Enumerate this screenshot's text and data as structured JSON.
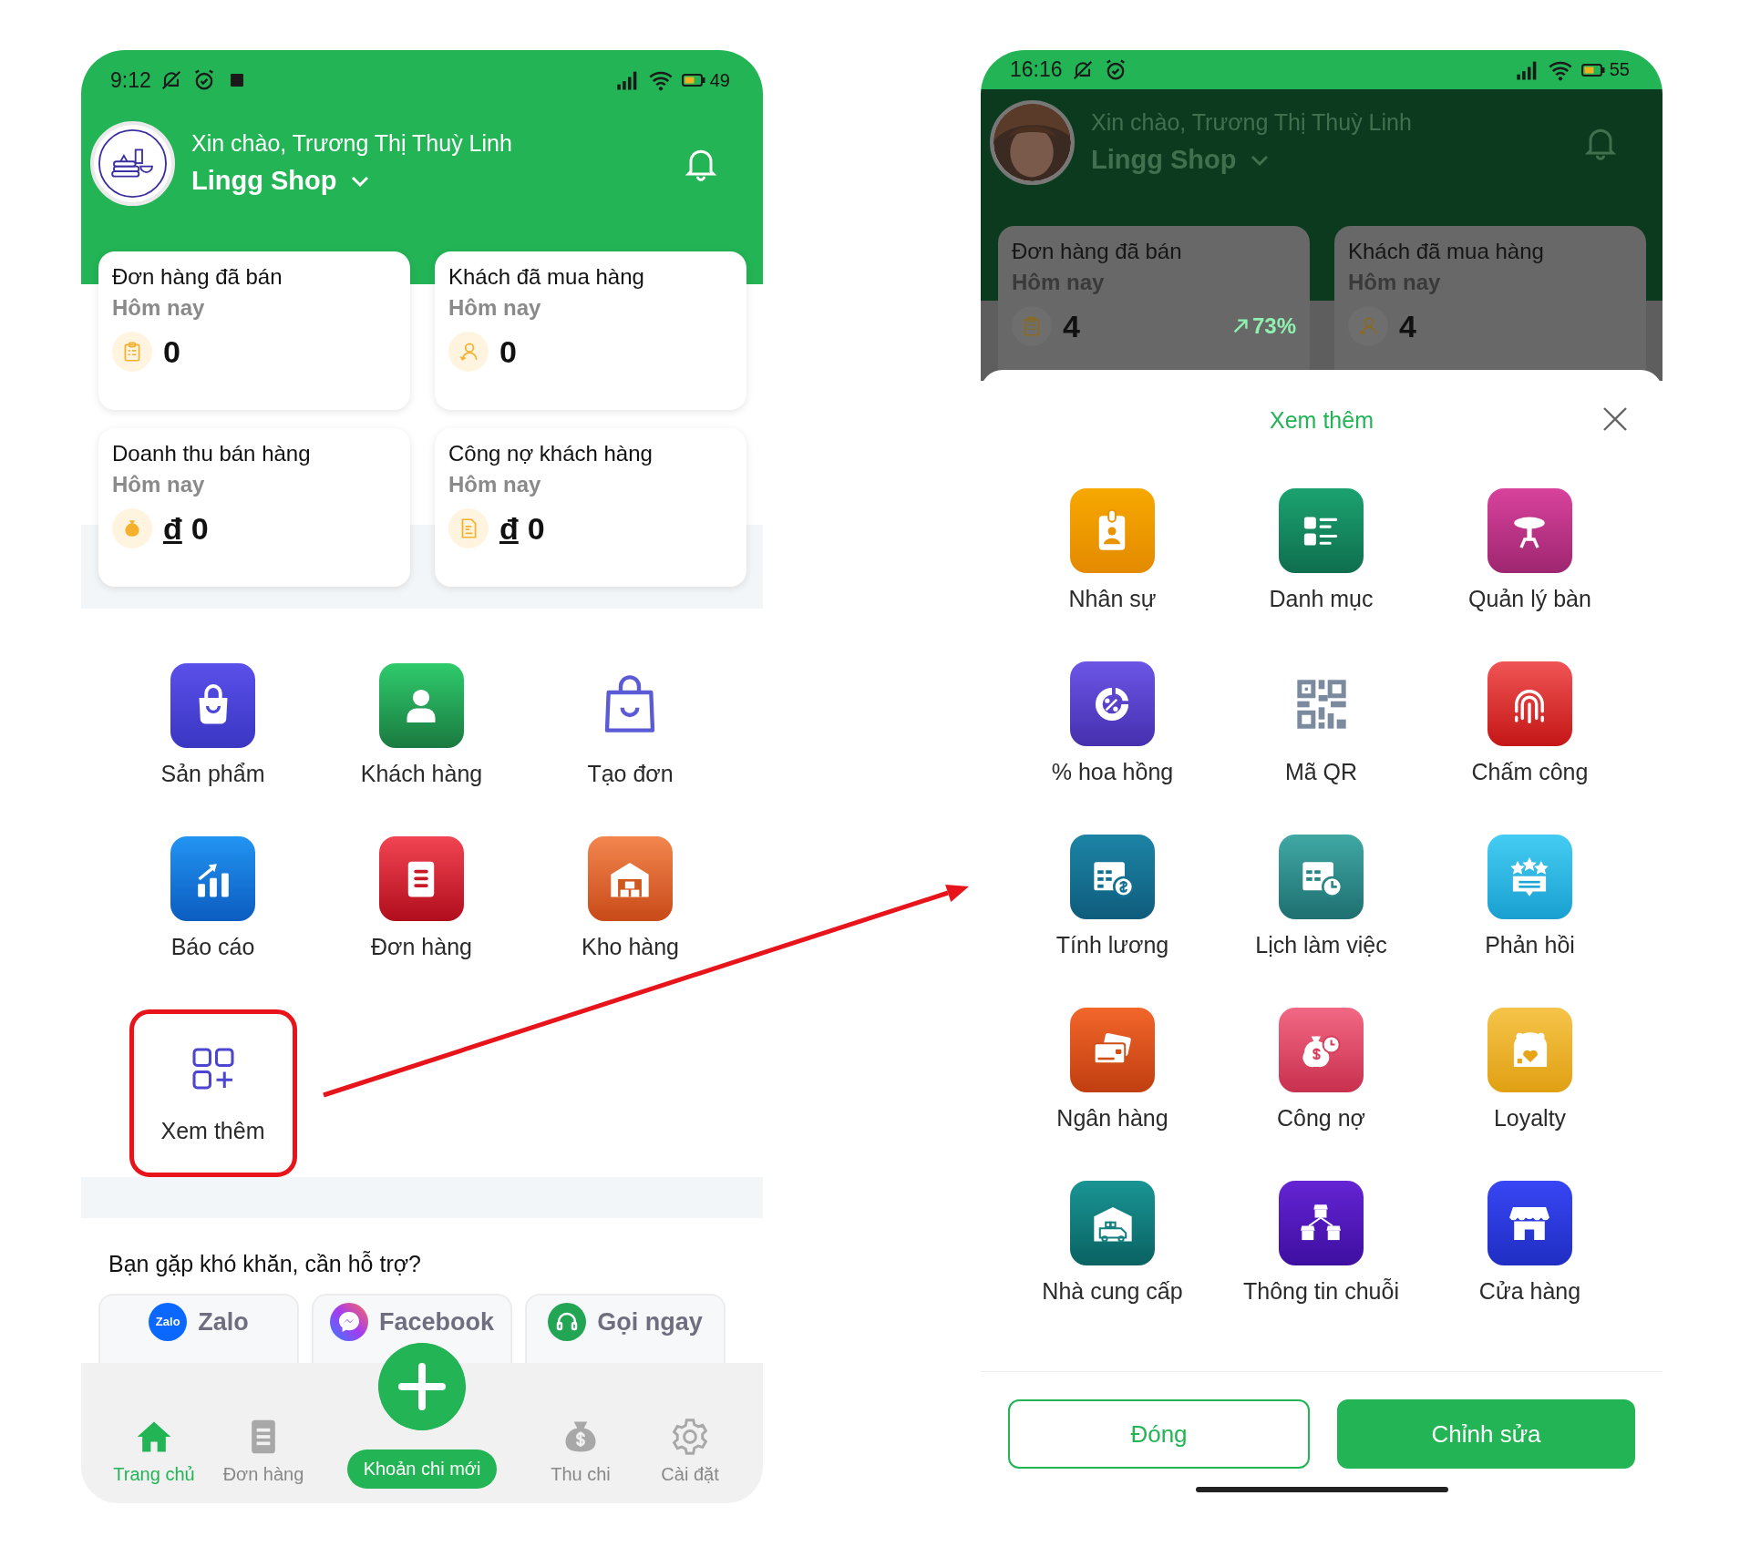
{
  "screens": [
    {
      "kind": "home",
      "status_bar": {
        "time": "9:12",
        "battery": "49",
        "indicator": true
      },
      "dimmed": false,
      "header": {
        "greeting": "Xin chào, Trương Thị Thuỳ Linh",
        "shop": "Lingg Shop"
      },
      "stats": [
        {
          "title": "Đơn hàng đã bán",
          "period": "Hôm nay",
          "value": "0"
        },
        {
          "title": "Khách đã mua hàng",
          "period": "Hôm nay",
          "value": "0"
        },
        {
          "title": "Doanh thu bán hàng",
          "period": "Hôm nay",
          "currency": "đ",
          "value": "0"
        },
        {
          "title": "Công nợ khách hàng",
          "period": "Hôm nay",
          "currency": "đ",
          "value": "0"
        }
      ],
      "menu": [
        {
          "label": "Sản phẩm",
          "highlighted": false
        },
        {
          "label": "Khách hàng",
          "highlighted": false
        },
        {
          "label": "Tạo đơn",
          "highlighted": false
        },
        {
          "label": "Báo cáo",
          "highlighted": false
        },
        {
          "label": "Đơn hàng",
          "highlighted": false
        },
        {
          "label": "Kho hàng",
          "highlighted": false
        },
        {
          "label": "Xem thêm",
          "highlighted": true
        }
      ],
      "support": {
        "prompt": "Bạn gặp khó khăn, cần hỗ trợ?",
        "buttons": [
          {
            "label": "Zalo",
            "badge": "Zalo"
          },
          {
            "label": "Facebook"
          },
          {
            "label": "Gọi ngay"
          }
        ]
      },
      "bottom_nav": {
        "items": [
          {
            "label": "Trang chủ",
            "selected": true
          },
          {
            "label": "Đơn hàng",
            "selected": false
          },
          {
            "label": "Thu chi",
            "selected": false
          },
          {
            "label": "Cài đặt",
            "selected": false
          }
        ],
        "fab_label": "Khoản chi mới"
      }
    },
    {
      "kind": "sheet",
      "status_bar": {
        "time": "16:16",
        "battery": "55",
        "indicator": false
      },
      "dimmed": true,
      "header": {
        "greeting": "Xin chào, Trương Thị Thuỳ Linh",
        "shop": "Lingg Shop"
      },
      "stats": [
        {
          "title": "Đơn hàng đã bán",
          "period": "Hôm nay",
          "value": "4",
          "trend": "73%"
        },
        {
          "title": "Khách đã mua hàng",
          "period": "Hôm nay",
          "value": "4"
        }
      ],
      "sheet": {
        "title": "Xem thêm",
        "items": [
          {
            "label": "Nhân sự"
          },
          {
            "label": "Danh mục"
          },
          {
            "label": "Quản lý bàn"
          },
          {
            "label": "% hoa hồng"
          },
          {
            "label": "Mã QR"
          },
          {
            "label": "Chấm công"
          },
          {
            "label": "Tính lương"
          },
          {
            "label": "Lịch làm việc"
          },
          {
            "label": "Phản hồi"
          },
          {
            "label": "Ngân hàng"
          },
          {
            "label": "Công nợ"
          },
          {
            "label": "Loyalty"
          },
          {
            "label": "Nhà cung cấp"
          },
          {
            "label": "Thông tin chuỗi"
          },
          {
            "label": "Cửa hàng"
          }
        ],
        "buttons": [
          {
            "label": "Đóng",
            "kind": "outline"
          },
          {
            "label": "Chỉnh sửa",
            "kind": "primary"
          }
        ]
      }
    }
  ]
}
